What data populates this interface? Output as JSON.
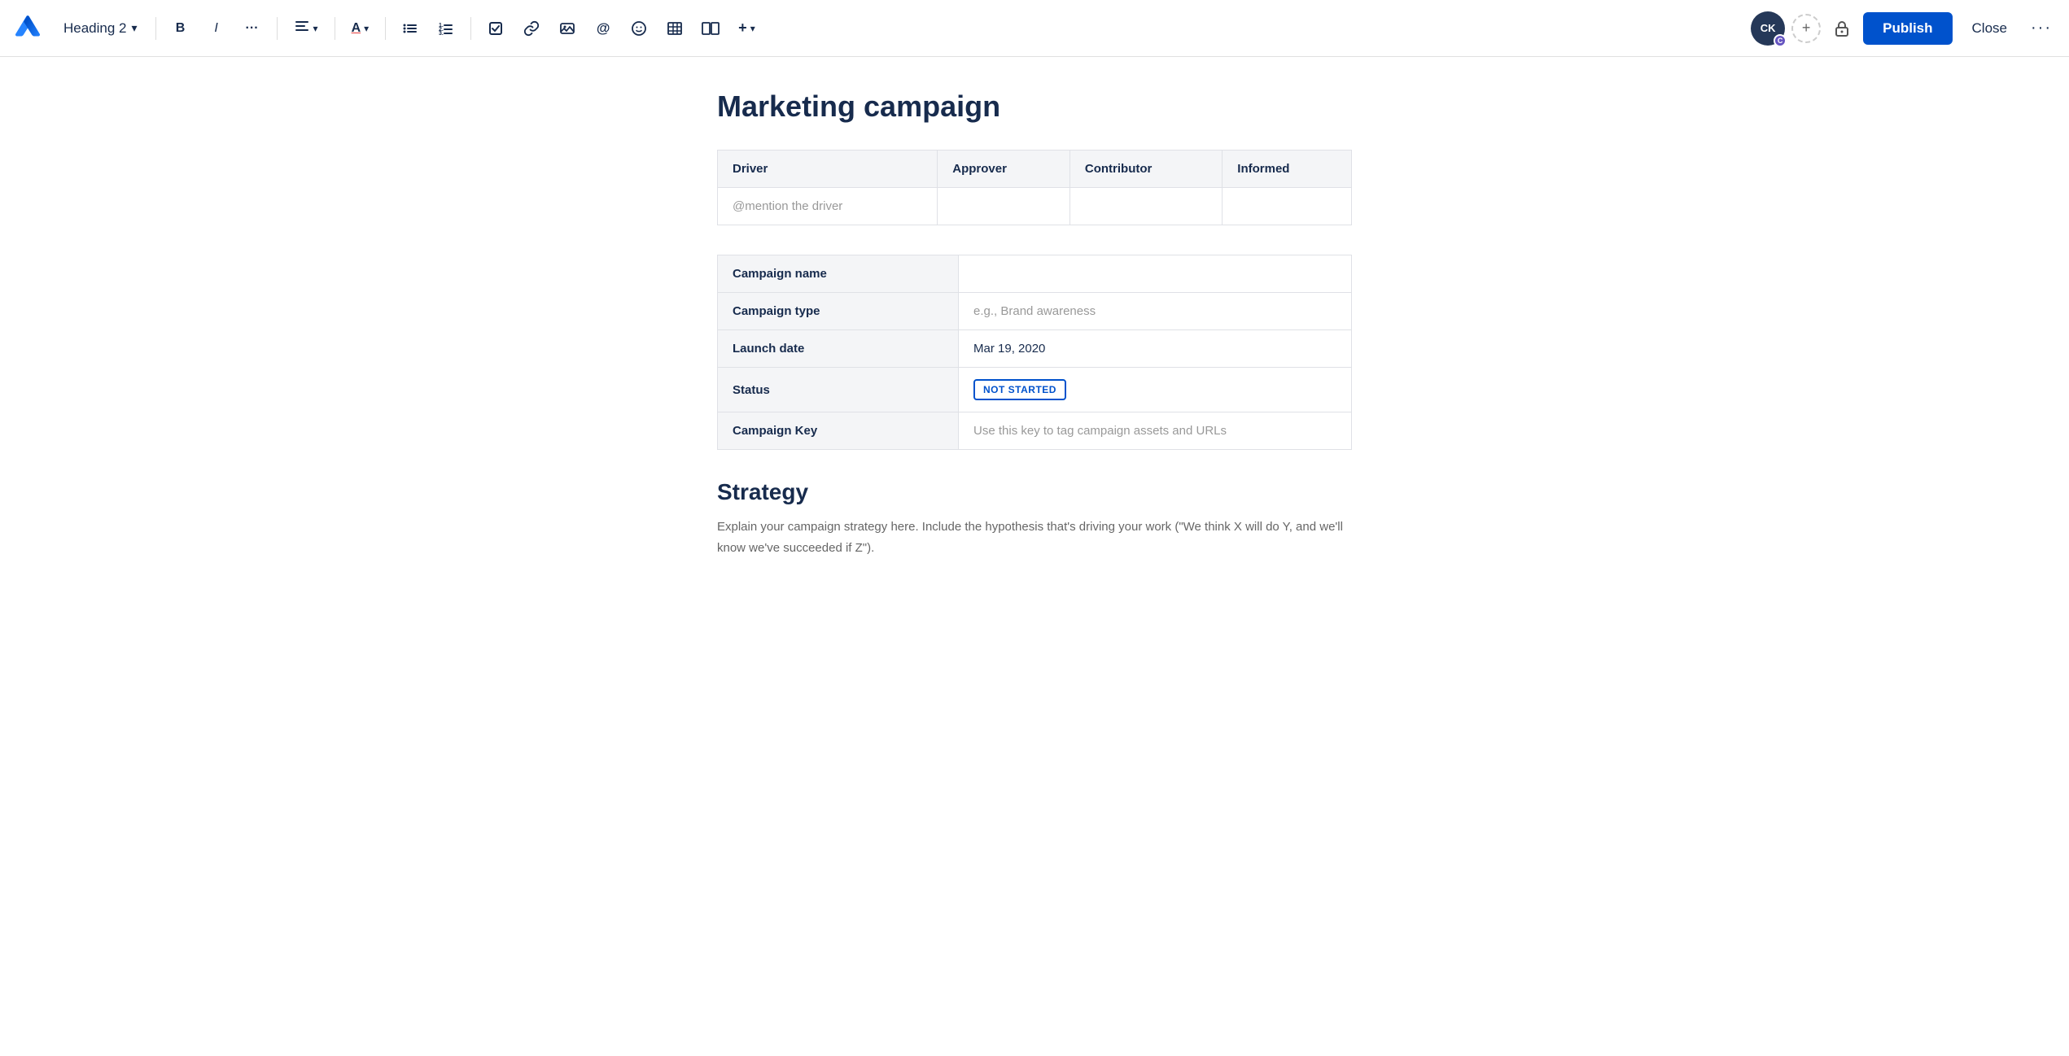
{
  "app": {
    "logo_label": "Confluence"
  },
  "toolbar": {
    "heading_label": "Heading 2",
    "chevron_down": "▾",
    "bold_label": "B",
    "italic_label": "I",
    "more_text_label": "···",
    "align_label": "≡",
    "text_color_label": "A",
    "bullet_list_label": "☰",
    "numbered_list_label": "①",
    "task_label": "☑",
    "link_label": "🔗",
    "image_label": "🖼",
    "mention_label": "@",
    "emoji_label": "☺",
    "table_label": "⊞",
    "layout_label": "⊟",
    "insert_label": "+",
    "avatar_initials": "CK",
    "avatar_badge": "C",
    "add_user_label": "+",
    "lock_label": "🔒",
    "publish_label": "Publish",
    "close_label": "Close",
    "more_label": "···"
  },
  "page": {
    "title": "Marketing campaign"
  },
  "daci_table": {
    "headers": [
      "Driver",
      "Approver",
      "Contributor",
      "Informed"
    ],
    "row": {
      "driver_placeholder": "@mention the driver",
      "approver_placeholder": "",
      "contributor_placeholder": "",
      "informed_placeholder": ""
    }
  },
  "campaign_table": {
    "rows": [
      {
        "label": "Campaign name",
        "value": "",
        "type": "empty"
      },
      {
        "label": "Campaign type",
        "value": "e.g., Brand awareness",
        "type": "placeholder"
      },
      {
        "label": "Launch date",
        "value": "Mar 19, 2020",
        "type": "value"
      },
      {
        "label": "Status",
        "value": "NOT STARTED",
        "type": "badge"
      },
      {
        "label": "Campaign Key",
        "value": "Use this key to tag campaign assets and URLs",
        "type": "placeholder"
      }
    ]
  },
  "strategy": {
    "heading": "Strategy",
    "body": "Explain your campaign strategy here. Include the hypothesis that's driving your work (\"We think X will do Y, and we'll know we've succeeded if Z\")."
  },
  "colors": {
    "brand_blue": "#0052cc",
    "text_dark": "#172b4d",
    "text_light": "#666",
    "bg_light": "#f4f5f7",
    "border": "#dfe1e6"
  }
}
